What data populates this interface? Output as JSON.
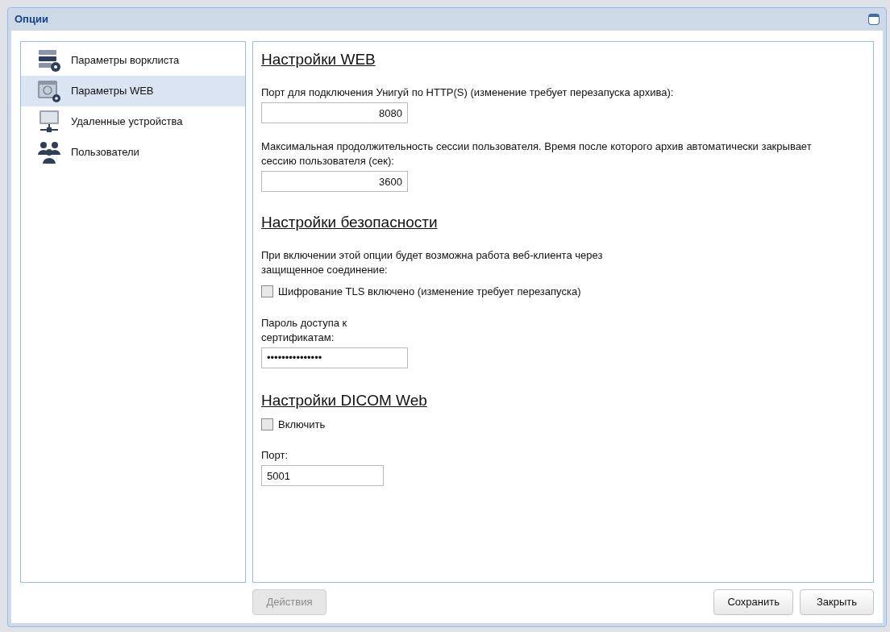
{
  "window": {
    "title": "Опции"
  },
  "sidebar": {
    "items": [
      {
        "label": "Параметры ворклиста",
        "selected": false
      },
      {
        "label": "Параметры WEB",
        "selected": true
      },
      {
        "label": "Удаленные устройства",
        "selected": false
      },
      {
        "label": "Пользователи",
        "selected": false
      }
    ]
  },
  "sections": [
    {
      "title": "Настройки WEB",
      "items": [
        {
          "kind": "text",
          "text": "Порт для подключения Унигуй по HTTP(S) (изменение требует перезапуска архива):"
        },
        {
          "kind": "number",
          "value": "8080"
        },
        {
          "kind": "text",
          "text": "Максимальная продолжительность сессии пользователя. Время после которого архив автоматически закрывает сессию пользователя (сек):"
        },
        {
          "kind": "number",
          "value": "3600"
        }
      ]
    },
    {
      "title": "Настройки безопасности",
      "items": [
        {
          "kind": "text",
          "text": "При включении этой опции будет возможна работа веб-клиента через защищенное соединение:"
        },
        {
          "kind": "checkbox",
          "label": "Шифрование TLS включено (изменение требует перезапуска)",
          "checked": false
        },
        {
          "kind": "label",
          "text": "Пароль доступа к сертификатам:"
        },
        {
          "kind": "password",
          "value": "•••••••••••••••"
        }
      ]
    },
    {
      "title": "Настройки DICOM Web",
      "items": [
        {
          "kind": "checkbox",
          "label": "Включить",
          "checked": false
        },
        {
          "kind": "text",
          "text": "Порт:"
        },
        {
          "kind": "input",
          "value": "5001"
        }
      ]
    }
  ],
  "buttons": [
    {
      "label": "Действия",
      "disabled": true
    },
    {
      "label": "Сохранить",
      "disabled": false
    },
    {
      "label": "Закрыть",
      "disabled": false
    }
  ]
}
